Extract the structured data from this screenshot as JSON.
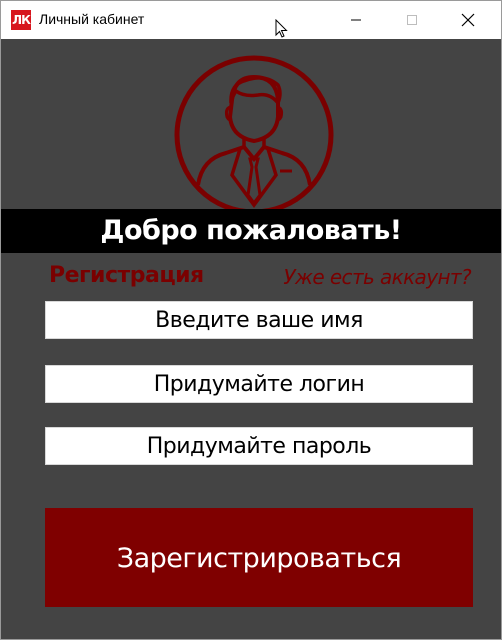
{
  "window": {
    "title": "Личный кабинет",
    "app_icon_text": "ЛК"
  },
  "main": {
    "welcome_text": "Добро пожаловать!",
    "registration_title": "Регистрация",
    "have_account_link": "Уже есть аккаунт?",
    "fields": {
      "name_placeholder": "Введите ваше имя",
      "login_placeholder": "Придумайте логин",
      "password_placeholder": "Придумайте пароль"
    },
    "register_button": "Зарегистрироваться"
  },
  "colors": {
    "background": "#444444",
    "accent": "#7f0000",
    "welcome_bar": "#000000",
    "field_bg": "#ffffff"
  },
  "icons": {
    "avatar": "user-avatar-icon",
    "minimize": "minimize-icon",
    "maximize": "maximize-icon",
    "close": "close-icon",
    "cursor": "mouse-cursor-icon"
  }
}
